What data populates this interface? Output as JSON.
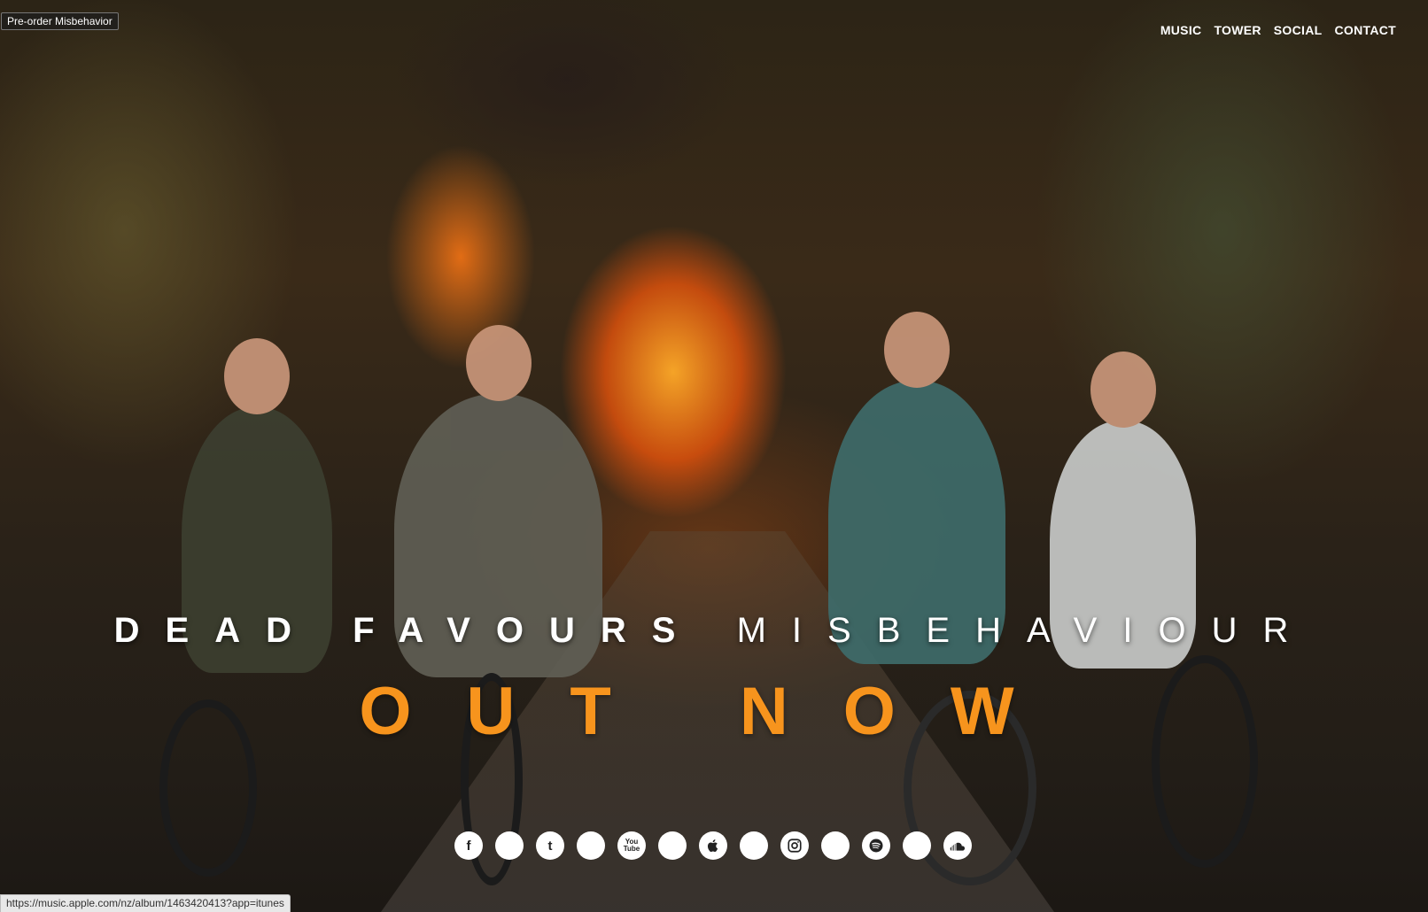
{
  "preorder_label": "Pre-order Misbehavior",
  "nav": {
    "music": "MUSIC",
    "tower": "TOWER",
    "social": "SOCIAL",
    "contact": "CONTACT"
  },
  "hero": {
    "band": "DEAD FAVOURS",
    "album": "MISBEHAVIOUR",
    "tagline": "OUT NOW"
  },
  "socials": [
    {
      "icon": "facebook-icon",
      "glyph": "f"
    },
    {
      "icon": "blank-icon",
      "glyph": ""
    },
    {
      "icon": "tumblr-icon",
      "glyph": "t"
    },
    {
      "icon": "blank-icon",
      "glyph": ""
    },
    {
      "icon": "youtube-icon",
      "glyph": "You Tube"
    },
    {
      "icon": "blank-icon",
      "glyph": ""
    },
    {
      "icon": "apple-icon",
      "glyph": ""
    },
    {
      "icon": "blank-icon",
      "glyph": ""
    },
    {
      "icon": "instagram-icon",
      "glyph": ""
    },
    {
      "icon": "blank-icon",
      "glyph": ""
    },
    {
      "icon": "spotify-icon",
      "glyph": ""
    },
    {
      "icon": "blank-icon",
      "glyph": ""
    },
    {
      "icon": "soundcloud-icon",
      "glyph": ""
    }
  ],
  "status_url": "https://music.apple.com/nz/album/1463420413?app=itunes",
  "colors": {
    "accent": "#f7941d",
    "text": "#ffffff"
  }
}
